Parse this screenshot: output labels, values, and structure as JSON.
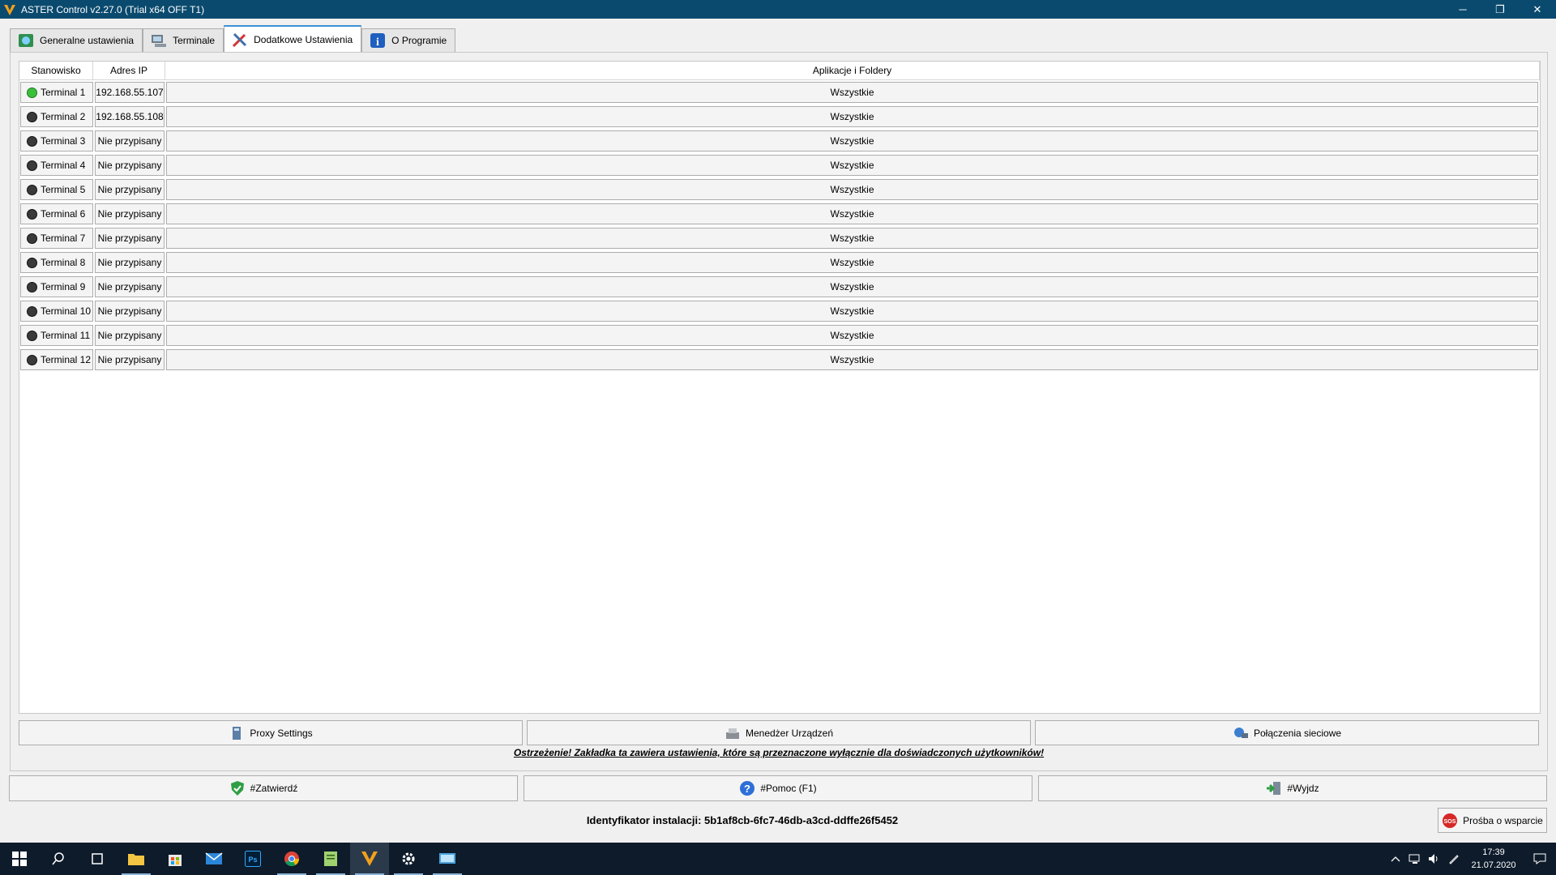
{
  "window": {
    "title": "ASTER Control v2.27.0 (Trial x64 OFF T1)",
    "controls": {
      "minimize": "─",
      "restore": "❐",
      "close": "✕"
    }
  },
  "tabs": [
    {
      "label": "Generalne ustawienia",
      "icon": "globe-settings-icon"
    },
    {
      "label": "Terminale",
      "icon": "terminal-icon"
    },
    {
      "label": "Dodatkowe Ustawienia",
      "icon": "tools-icon",
      "active": true
    },
    {
      "label": "O Programie",
      "icon": "info-icon"
    }
  ],
  "grid": {
    "headers": [
      "Stanowisko",
      "Adres IP",
      "Aplikacje i Foldery"
    ],
    "rows": [
      {
        "name": "Terminal 1",
        "ip": "192.168.55.107",
        "apps": "Wszystkie",
        "status": "online"
      },
      {
        "name": "Terminal 2",
        "ip": "192.168.55.108",
        "apps": "Wszystkie",
        "status": "offline"
      },
      {
        "name": "Terminal 3",
        "ip": "Nie przypisany",
        "apps": "Wszystkie",
        "status": "offline"
      },
      {
        "name": "Terminal 4",
        "ip": "Nie przypisany",
        "apps": "Wszystkie",
        "status": "offline"
      },
      {
        "name": "Terminal 5",
        "ip": "Nie przypisany",
        "apps": "Wszystkie",
        "status": "offline"
      },
      {
        "name": "Terminal 6",
        "ip": "Nie przypisany",
        "apps": "Wszystkie",
        "status": "offline"
      },
      {
        "name": "Terminal 7",
        "ip": "Nie przypisany",
        "apps": "Wszystkie",
        "status": "offline"
      },
      {
        "name": "Terminal 8",
        "ip": "Nie przypisany",
        "apps": "Wszystkie",
        "status": "offline"
      },
      {
        "name": "Terminal 9",
        "ip": "Nie przypisany",
        "apps": "Wszystkie",
        "status": "offline"
      },
      {
        "name": "Terminal 10",
        "ip": "Nie przypisany",
        "apps": "Wszystkie",
        "status": "offline"
      },
      {
        "name": "Terminal 11",
        "ip": "Nie przypisany",
        "apps": "Wszystkie",
        "status": "offline"
      },
      {
        "name": "Terminal 12",
        "ip": "Nie przypisany",
        "apps": "Wszystkie",
        "status": "offline"
      }
    ]
  },
  "panel_buttons": {
    "proxy": "Proxy Settings",
    "device_manager": "Menedżer Urządzeń",
    "network": "Połączenia sieciowe"
  },
  "warning": "Ostrzeżenie! Zakładka ta zawiera ustawienia, które są przeznaczone wyłącznie dla doświadczonych użytkowników!",
  "footer_buttons": {
    "confirm": "#Zatwierdź",
    "help": "#Pomoc (F1)",
    "exit": "#Wyjdz"
  },
  "install_id": "Identyfikator instalacji: 5b1af8cb-6fc7-46db-a3cd-ddffe26f5452",
  "support_button": "Prośba o wsparcie",
  "clock": {
    "time": "17:39",
    "date": "21.07.2020"
  },
  "colors": {
    "titlebar": "#0a4a6e",
    "status_online": "#3cbf3c",
    "status_offline": "#3a3a3a",
    "taskbar": "#0e1b2b"
  }
}
